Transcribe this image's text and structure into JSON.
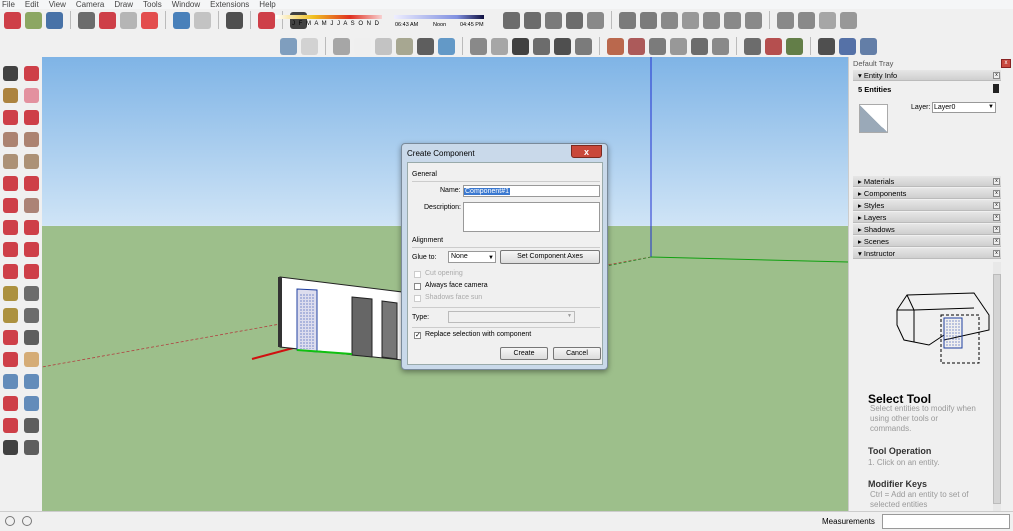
{
  "menu": [
    "File",
    "Edit",
    "View",
    "Camera",
    "Draw",
    "Tools",
    "Window",
    "Extensions",
    "Help"
  ],
  "toolbar_top": {
    "icons": [
      [
        "new-icon",
        "#c8202a"
      ],
      [
        "open-icon",
        "#7a9a4a"
      ],
      [
        "save-icon",
        "#2a5c9a"
      ],
      [
        "sep"
      ],
      [
        "cut-icon",
        "#555"
      ],
      [
        "copy-icon",
        "#c8202a"
      ],
      [
        "paste-icon",
        "#aaa"
      ],
      [
        "erase-icon",
        "#e03030"
      ],
      [
        "sep"
      ],
      [
        "undo-icon",
        "#2a6cb0"
      ],
      [
        "redo-icon",
        "#bbb"
      ],
      [
        "sep"
      ],
      [
        "print-icon",
        "#333"
      ],
      [
        "sep"
      ],
      [
        "model-info-icon",
        "#c8202a"
      ],
      [
        "sep"
      ],
      [
        "shadows-toggle-icon",
        "#222"
      ]
    ],
    "months": "J F M A M J J A S O N D",
    "time_start": "06:43 AM",
    "time_mid": "Noon",
    "time_end": "04:45 PM",
    "icons_right": [
      [
        "xray-icon",
        "#555"
      ],
      [
        "teapot-icon",
        "#555"
      ],
      [
        "camera-icon",
        "#666"
      ],
      [
        "monitor-icon",
        "#555"
      ],
      [
        "lock-icon",
        "#777"
      ],
      [
        "sep"
      ],
      [
        "grad-cap-icon",
        "#666"
      ],
      [
        "geo-icon",
        "#666"
      ],
      [
        "sphere-icon",
        "#777"
      ],
      [
        "pencil-icon",
        "#888"
      ],
      [
        "torch-icon",
        "#777"
      ],
      [
        "sun-icon",
        "#777"
      ],
      [
        "sunset-icon",
        "#777"
      ],
      [
        "sep"
      ],
      [
        "fog-icon",
        "#777"
      ],
      [
        "terrain-icon",
        "#777"
      ],
      [
        "grass-icon",
        "#999"
      ],
      [
        "plant-icon",
        "#888"
      ]
    ]
  },
  "toolbar_second": {
    "icons": [
      [
        "iso-view-icon",
        "#6b8fb5"
      ],
      [
        "top-view-icon",
        "#ccc"
      ],
      [
        "sep"
      ],
      [
        "xray-style-icon",
        "#999"
      ],
      [
        "wireframe-icon",
        "#eee"
      ],
      [
        "hidden-line-icon",
        "#bbb"
      ],
      [
        "shaded-icon",
        "#9a9a80"
      ],
      [
        "shaded-texture-icon",
        "#444"
      ],
      [
        "monochrome-icon",
        "#4a8ac0"
      ],
      [
        "sep"
      ],
      [
        "iso-house-icon",
        "#777"
      ],
      [
        "door-icon",
        "#999"
      ],
      [
        "home-icon",
        "#222"
      ],
      [
        "front-icon",
        "#555"
      ],
      [
        "back-icon",
        "#333"
      ],
      [
        "left-icon",
        "#666"
      ],
      [
        "sep"
      ],
      [
        "sandbox-icon",
        "#b05030"
      ],
      [
        "drape-icon",
        "#a04040"
      ],
      [
        "stamp-icon",
        "#666"
      ],
      [
        "smoove-icon",
        "#888"
      ],
      [
        "add-detail-icon",
        "#555"
      ],
      [
        "flip-edge-icon",
        "#777"
      ],
      [
        "sep"
      ],
      [
        "rotate-icon",
        "#555"
      ],
      [
        "get-models-icon",
        "#aa3333"
      ],
      [
        "share-icon",
        "#4a6a2a"
      ],
      [
        "sep"
      ],
      [
        "position-camera-icon",
        "#333"
      ],
      [
        "walk-icon",
        "#3a5a9a"
      ],
      [
        "look-around-icon",
        "#4a6a9a"
      ]
    ]
  },
  "left_toolbar": {
    "icons": [
      [
        "select-icon",
        "#222"
      ],
      [
        "make-component-icon",
        "#c8202a"
      ],
      [
        "paint-bucket-icon",
        "#a07020"
      ],
      [
        "eraser-icon",
        "#e08090"
      ],
      [
        "line-icon",
        "#c8202a"
      ],
      [
        "freehand-icon",
        "#c8202a"
      ],
      [
        "rectangle-icon",
        "#a0705a"
      ],
      [
        "rotated-rect-icon",
        "#a0705a"
      ],
      [
        "circle-icon",
        "#a08060"
      ],
      [
        "polygon-icon",
        "#a08060"
      ],
      [
        "arc-icon",
        "#c8202a"
      ],
      [
        "arc2-icon",
        "#c8202a"
      ],
      [
        "pie-icon",
        "#c8202a"
      ],
      [
        "arc3-icon",
        "#a07060"
      ],
      [
        "move-icon",
        "#c8202a"
      ],
      [
        "push-pull-icon",
        "#c8202a"
      ],
      [
        "rotate-tool-icon",
        "#c8202a"
      ],
      [
        "follow-me-icon",
        "#c8202a"
      ],
      [
        "scale-icon",
        "#c8202a"
      ],
      [
        "offset-icon",
        "#c8202a"
      ],
      [
        "tape-icon",
        "#a08020"
      ],
      [
        "dimension-icon",
        "#555"
      ],
      [
        "protractor-icon",
        "#a08020"
      ],
      [
        "text-icon",
        "#555"
      ],
      [
        "axes-icon",
        "#c8202a"
      ],
      [
        "3d-text-icon",
        "#444"
      ],
      [
        "orbit-icon",
        "#c8202a"
      ],
      [
        "pan-icon",
        "#d0a060"
      ],
      [
        "zoom-icon",
        "#4a7ab0"
      ],
      [
        "zoom-window-icon",
        "#4a7ab0"
      ],
      [
        "zoom-extents-icon",
        "#c8202a"
      ],
      [
        "prev-view-icon",
        "#4a7ab0"
      ],
      [
        "position-cam-icon",
        "#c8202a"
      ],
      [
        "look-around-tool-icon",
        "#444"
      ],
      [
        "walk-tool-icon",
        "#222"
      ],
      [
        "section-plane-icon",
        "#444"
      ]
    ]
  },
  "dialog": {
    "title": "Create Component",
    "close": "x",
    "general": "General",
    "name_label": "Name:",
    "name_value": "Component#1",
    "description_label": "Description:",
    "description_value": "",
    "alignment": "Alignment",
    "glue_label": "Glue to:",
    "glue_value": "None",
    "set_axes": "Set Component Axes",
    "cut_opening": "Cut opening",
    "always_face": "Always face camera",
    "shadows_face": "Shadows face sun",
    "type_label": "Type:",
    "type_value": "",
    "replace": "Replace selection with component",
    "replace_checked": true,
    "create": "Create",
    "cancel": "Cancel"
  },
  "tray": {
    "title": "Default Tray",
    "entity_info": "Entity Info",
    "entities": "5 Entities",
    "layer_label": "Layer:",
    "layer_value": "Layer0",
    "panels": [
      "Materials",
      "Components",
      "Styles",
      "Layers",
      "Shadows",
      "Scenes"
    ],
    "instructor": "Instructor",
    "tool_title": "Select Tool",
    "tool_desc": "Select entities to modify when using other tools or commands.",
    "op_title": "Tool Operation",
    "op_step": "1.   Click on an entity.",
    "mod_title": "Modifier Keys",
    "mod_text": "Ctrl = Add an entity to set of selected entities"
  },
  "status": {
    "measurements_label": "Measurements",
    "measurements_value": ""
  }
}
